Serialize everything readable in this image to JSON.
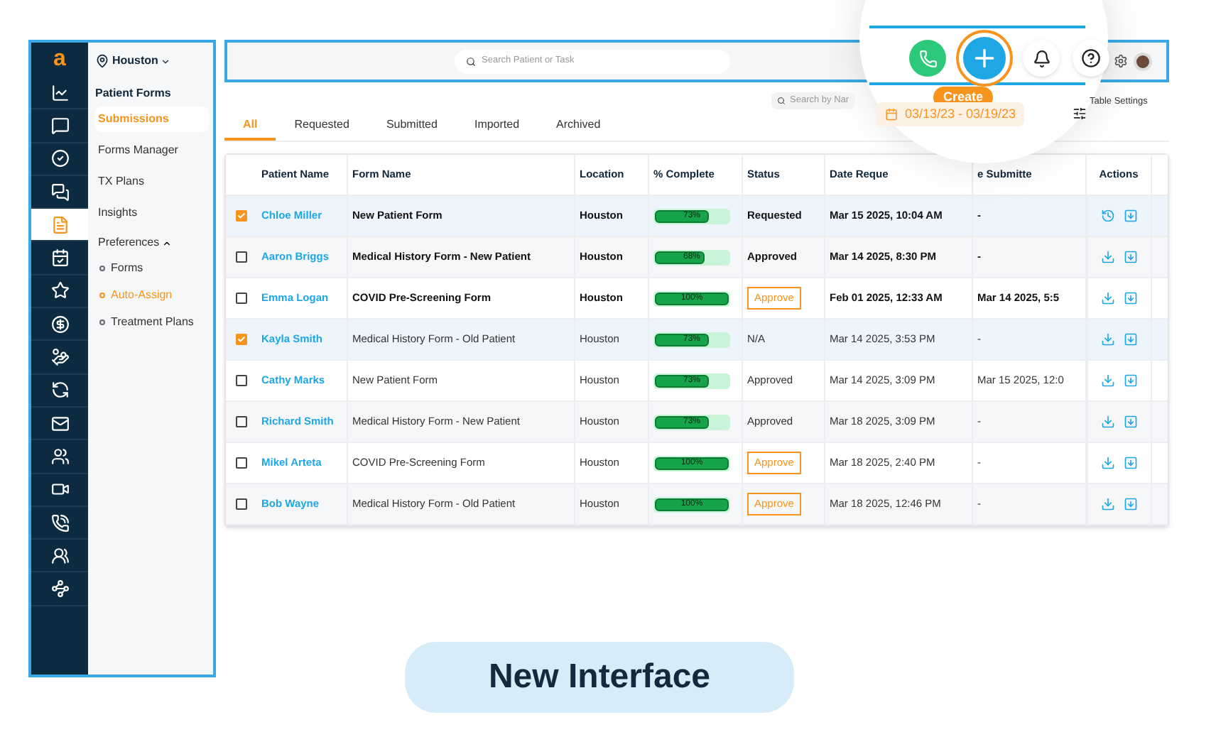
{
  "rail": {
    "logo": "a",
    "items": [
      {
        "selected": false
      },
      {
        "selected": false
      },
      {
        "selected": false
      },
      {
        "selected": false
      },
      {
        "selected": true
      },
      {
        "selected": false
      },
      {
        "selected": false
      },
      {
        "selected": false
      },
      {
        "selected": false
      },
      {
        "selected": false
      },
      {
        "selected": false
      },
      {
        "selected": false
      },
      {
        "selected": false
      },
      {
        "selected": false
      },
      {
        "selected": false
      },
      {
        "selected": false
      }
    ]
  },
  "location": "Houston",
  "nav": {
    "heading": "Patient Forms",
    "items": [
      {
        "label": "Submissions",
        "selected": true
      },
      {
        "label": "Forms Manager",
        "selected": false
      },
      {
        "label": "TX Plans",
        "selected": false
      },
      {
        "label": "Insights",
        "selected": false
      }
    ],
    "preferences": {
      "label": "Preferences",
      "expanded": true,
      "children": [
        {
          "label": "Forms",
          "selected": false
        },
        {
          "label": "Auto-Assign",
          "selected": true
        },
        {
          "label": "Treatment Plans",
          "selected": false
        }
      ]
    }
  },
  "search": {
    "placeholder": "Search Patient or Task"
  },
  "magnifier": {
    "create_label": "Create",
    "date_range": "03/13/23 - 03/19/23",
    "search_by_name": "Search by Nar",
    "table_settings": "Table Settings"
  },
  "tabs": [
    {
      "label": "All",
      "selected": true
    },
    {
      "label": "Requested",
      "selected": false
    },
    {
      "label": "Submitted",
      "selected": false
    },
    {
      "label": "Imported",
      "selected": false
    },
    {
      "label": "Archived",
      "selected": false
    }
  ],
  "table": {
    "columns": [
      "Patient Name",
      "Form Name",
      "Location",
      "% Complete",
      "Status",
      "Date Reque",
      "e Submitte",
      "Actions"
    ],
    "rows": [
      {
        "checked": true,
        "unread": true,
        "patient": "Chloe Miller",
        "form": "New Patient Form",
        "location": "Houston",
        "level": 0.73,
        "percent": "73%",
        "status": {
          "kind": "text",
          "label": "Requested"
        },
        "date_requested": "Mar 15 2025, 10:04 AM",
        "date_submitted": "-",
        "actions": [
          {
            "kind": "history"
          },
          {
            "kind": "archive"
          }
        ]
      },
      {
        "checked": false,
        "unread": true,
        "patient": "Aaron Briggs",
        "form": "Medical History Form - New Patient",
        "location": "Houston",
        "level": 0.68,
        "percent": "68%",
        "status": {
          "kind": "text",
          "label": "Approved"
        },
        "date_requested": "Mar 14 2025, 8:30 PM",
        "date_submitted": "-",
        "actions": [
          {
            "kind": "download"
          },
          {
            "kind": "archive"
          }
        ]
      },
      {
        "checked": false,
        "unread": true,
        "patient": "Emma Logan",
        "form": "COVID Pre-Screening Form",
        "location": "Houston",
        "level": 1,
        "percent": "100%",
        "status": {
          "kind": "button",
          "label": "Approve"
        },
        "date_requested": "Feb 01 2025, 12:33 AM",
        "date_submitted": "Mar 14 2025, 5:5",
        "actions": [
          {
            "kind": "download"
          },
          {
            "kind": "archive"
          }
        ]
      },
      {
        "checked": true,
        "unread": false,
        "patient": "Kayla Smith",
        "form": "Medical History Form - Old Patient",
        "location": "Houston",
        "level": 0.73,
        "percent": "73%",
        "status": {
          "kind": "text",
          "label": "N/A"
        },
        "date_requested": "Mar 14 2025, 3:53 PM",
        "date_submitted": "-",
        "actions": [
          {
            "kind": "download"
          },
          {
            "kind": "archive"
          }
        ]
      },
      {
        "checked": false,
        "unread": false,
        "patient": "Cathy Marks",
        "form": "New Patient Form",
        "location": "Houston",
        "level": 0.73,
        "percent": "73%",
        "status": {
          "kind": "text",
          "label": "Approved"
        },
        "date_requested": "Mar 14 2025, 3:09 PM",
        "date_submitted": "Mar 15 2025, 12:0",
        "actions": [
          {
            "kind": "download"
          },
          {
            "kind": "archive"
          }
        ]
      },
      {
        "checked": false,
        "unread": false,
        "patient": "Richard Smith",
        "form": "Medical History Form - New Patient",
        "location": "Houston",
        "level": 0.73,
        "percent": "73%",
        "status": {
          "kind": "text",
          "label": "Approved"
        },
        "date_requested": "Mar 18 2025, 3:09 PM",
        "date_submitted": "-",
        "actions": [
          {
            "kind": "download"
          },
          {
            "kind": "archive"
          }
        ]
      },
      {
        "checked": false,
        "unread": false,
        "patient": "Mikel Arteta",
        "form": "COVID Pre-Screening Form",
        "location": "Houston",
        "level": 1,
        "percent": "100%",
        "status": {
          "kind": "button",
          "label": "Approve"
        },
        "date_requested": "Mar 18 2025, 2:40 PM",
        "date_submitted": "-",
        "actions": [
          {
            "kind": "download"
          },
          {
            "kind": "archive"
          }
        ]
      },
      {
        "checked": false,
        "unread": false,
        "patient": "Bob Wayne",
        "form": "Medical History Form - Old Patient",
        "location": "Houston",
        "level": 1,
        "percent": "100%",
        "status": {
          "kind": "button",
          "label": "Approve"
        },
        "date_requested": "Mar 18 2025, 12:46 PM",
        "date_submitted": "-",
        "actions": [
          {
            "kind": "download"
          },
          {
            "kind": "archive"
          }
        ]
      }
    ]
  },
  "banner": "New Interface"
}
